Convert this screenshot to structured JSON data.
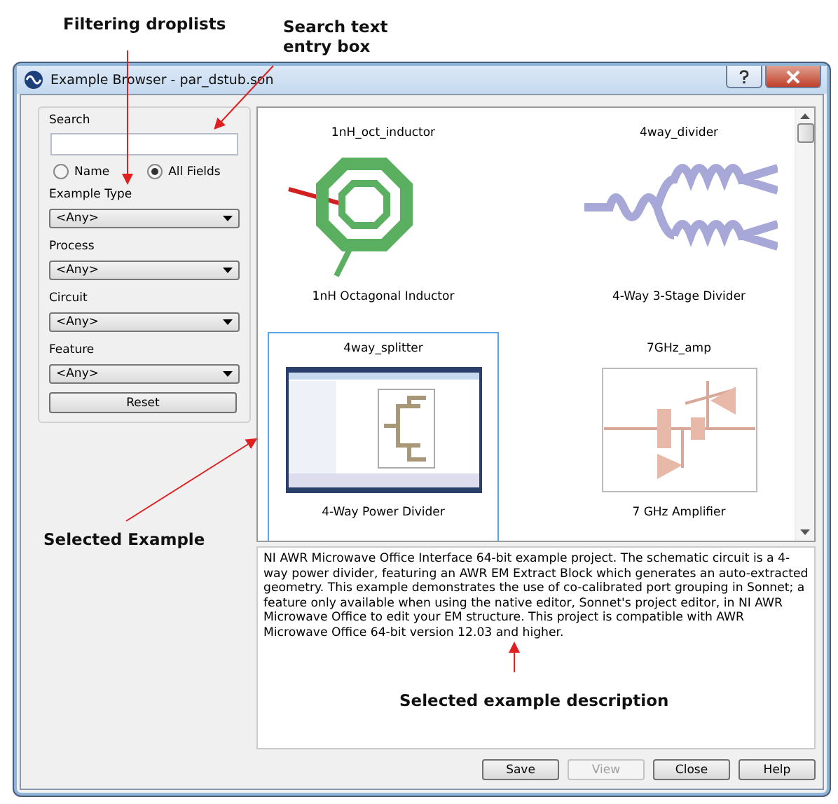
{
  "annotations": [
    {
      "text": "Filtering droplists"
    },
    {
      "text": "Search text entry box"
    },
    {
      "text": "Selected Example"
    },
    {
      "text": "Selected example description"
    }
  ],
  "window": {
    "title": "Example Browser - par_dstub.son"
  },
  "search": {
    "label": "Search"
  },
  "search_mode": [
    {
      "label": "Name",
      "selected": false
    },
    {
      "label": "All Fields",
      "selected": true
    }
  ],
  "filters": [
    {
      "label": "Example Type",
      "value": "<Any>"
    },
    {
      "label": "Process",
      "value": "<Any>"
    },
    {
      "label": "Circuit",
      "value": "<Any>"
    },
    {
      "label": "Feature",
      "value": "<Any>"
    }
  ],
  "reset_button": "Reset",
  "examples": [
    {
      "name": "1nH_oct_inductor",
      "caption": "1nH Octagonal Inductor",
      "kind": "inductor",
      "selected": false
    },
    {
      "name": "4way_divider",
      "caption": "4-Way 3-Stage Divider",
      "kind": "layout",
      "selected": false
    },
    {
      "name": "4way_splitter",
      "caption": "4-Way Power Divider",
      "kind": "screenshot",
      "selected": true
    },
    {
      "name": "7GHz_amp",
      "caption": "7 GHz Amplifier",
      "kind": "schematic",
      "selected": false
    }
  ],
  "description": "NI AWR Microwave Office Interface 64-bit example project. The schematic circuit is a 4-way power divider, featuring an AWR EM Extract Block which generates an auto-extracted geometry. This example demonstrates the use of co-calibrated port grouping in Sonnet; a feature only available when using the native editor, Sonnet's project editor, in NI AWR Microwave Office to edit your EM structure. This project is compatible with AWR Microwave Office 64-bit version 12.03 and higher.",
  "buttons": [
    {
      "label": "Save",
      "disabled": false
    },
    {
      "label": "View",
      "disabled": true
    },
    {
      "label": "Close",
      "disabled": false
    },
    {
      "label": "Help",
      "disabled": false
    }
  ]
}
